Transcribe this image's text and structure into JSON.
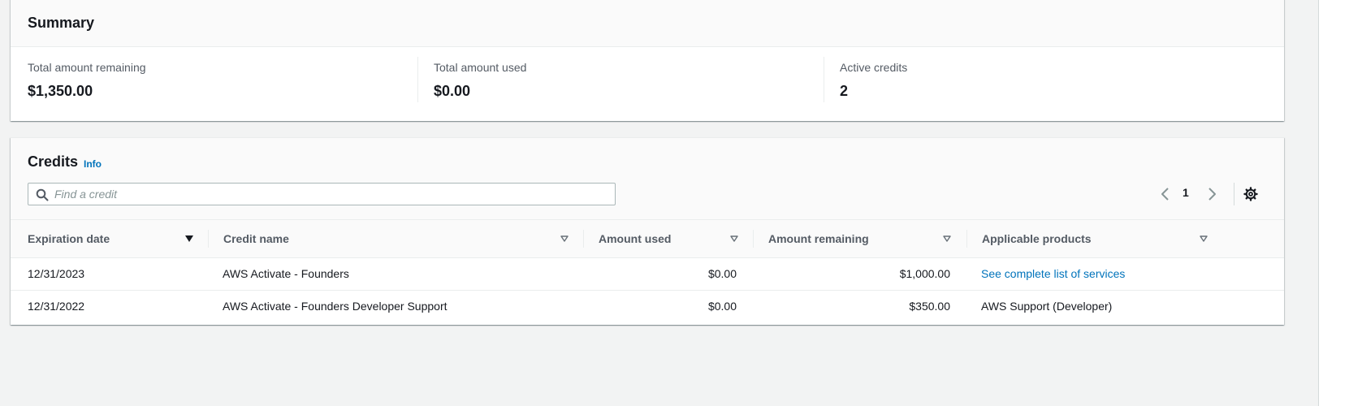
{
  "summary": {
    "title": "Summary",
    "items": [
      {
        "label": "Total amount remaining",
        "value": "$1,350.00"
      },
      {
        "label": "Total amount used",
        "value": "$0.00"
      },
      {
        "label": "Active credits",
        "value": "2"
      }
    ]
  },
  "credits": {
    "title": "Credits",
    "info_label": "Info",
    "search": {
      "placeholder": "Find a credit",
      "value": ""
    },
    "pagination": {
      "current_page": "1"
    },
    "columns": [
      {
        "label": "Expiration date",
        "sort": "descending"
      },
      {
        "label": "Credit name",
        "sort": "none"
      },
      {
        "label": "Amount used",
        "sort": "none"
      },
      {
        "label": "Amount remaining",
        "sort": "none"
      },
      {
        "label": "Applicable products",
        "sort": "none"
      }
    ],
    "rows": [
      {
        "expiration_date": "12/31/2023",
        "credit_name": "AWS Activate - Founders",
        "amount_used": "$0.00",
        "amount_remaining": "$1,000.00",
        "applicable_products": "See complete list of services",
        "applicable_products_is_link": true
      },
      {
        "expiration_date": "12/31/2022",
        "credit_name": "AWS Activate - Founders Developer Support",
        "amount_used": "$0.00",
        "amount_remaining": "$350.00",
        "applicable_products": "AWS Support (Developer)",
        "applicable_products_is_link": false
      }
    ]
  },
  "colors": {
    "link": "#0073bb",
    "text": "#16191f",
    "secondary_text": "#545b64",
    "page_background": "#f2f3f3"
  },
  "icons": {
    "search": "search-icon",
    "pager_prev": "chevron-left-icon",
    "pager_next": "chevron-right-icon",
    "settings": "gear-icon",
    "sort_active": "caret-down-filled-icon",
    "sort_inactive": "caret-down-outline-icon"
  }
}
